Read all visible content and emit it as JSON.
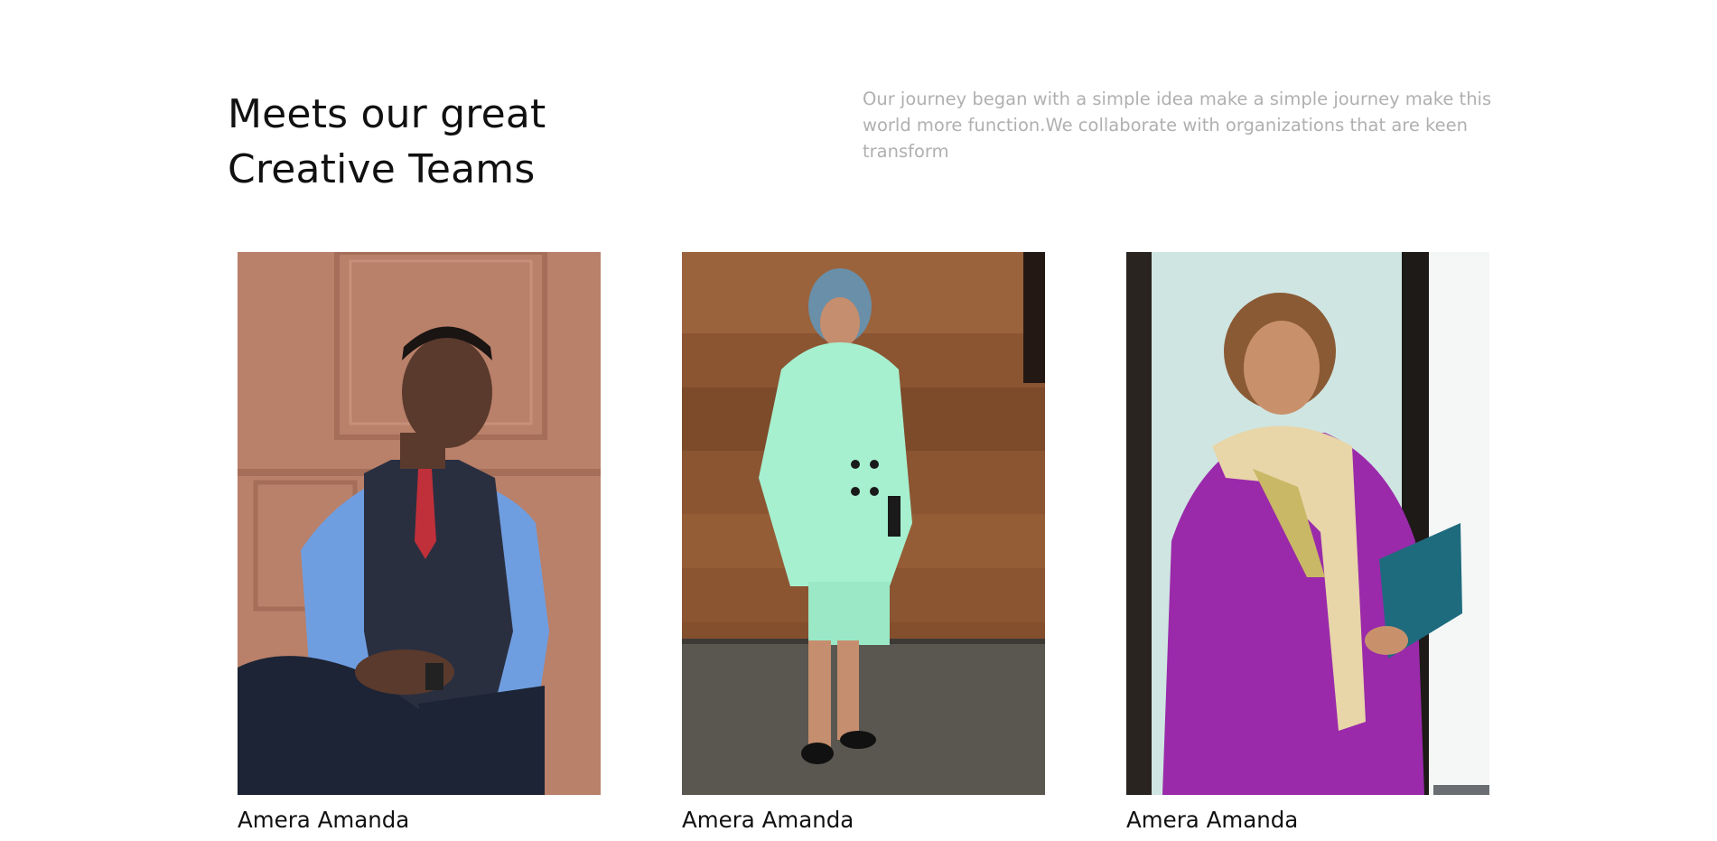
{
  "header": {
    "title_line1": "Meets our great",
    "title_line2": "Creative Teams",
    "description": "Our journey began with a simple idea make a simple journey make this world more function.We collaborate with organizations that are keen transform"
  },
  "team": [
    {
      "name": "Amera Amanda"
    },
    {
      "name": "Amera Amanda"
    },
    {
      "name": "Amera Amanda"
    }
  ],
  "colors": {
    "title": "#111111",
    "description": "#b0b0b0",
    "background": "#ffffff"
  }
}
